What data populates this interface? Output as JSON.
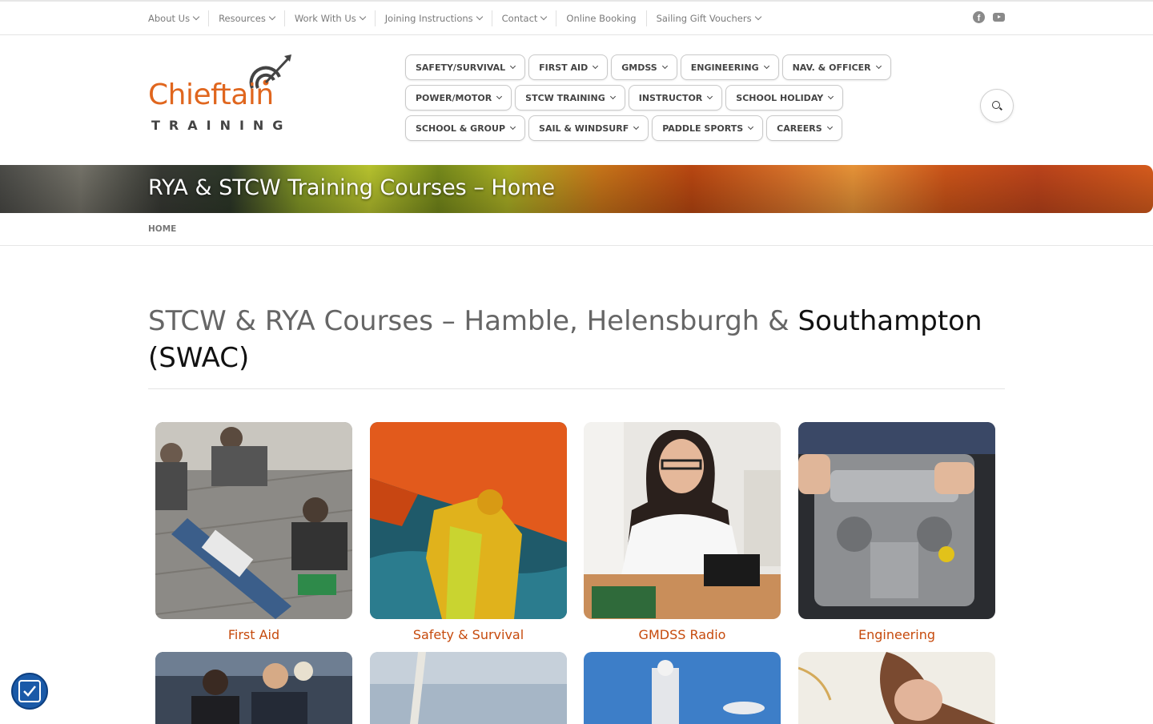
{
  "topnav": {
    "items": [
      {
        "label": "About Us",
        "dropdown": true
      },
      {
        "label": "Resources",
        "dropdown": true
      },
      {
        "label": "Work With Us",
        "dropdown": true
      },
      {
        "label": "Joining Instructions",
        "dropdown": true
      },
      {
        "label": "Contact",
        "dropdown": true
      },
      {
        "label": "Online Booking",
        "dropdown": false
      },
      {
        "label": "Sailing Gift Vouchers",
        "dropdown": true
      }
    ],
    "social": [
      "facebook-icon",
      "youtube-icon"
    ]
  },
  "logo": {
    "word": "Chieftain",
    "sub": "TRAINING",
    "color": "#e0661e"
  },
  "mainnav": {
    "rows": [
      [
        "SAFETY/SURVIVAL",
        "FIRST AID",
        "GMDSS",
        "ENGINEERING",
        "NAV. & OFFICER"
      ],
      [
        "POWER/MOTOR",
        "STCW TRAINING",
        "INSTRUCTOR",
        "SCHOOL HOLIDAY"
      ],
      [
        "SCHOOL & GROUP",
        "SAIL & WINDSURF",
        "PADDLE SPORTS",
        "CAREERS"
      ]
    ]
  },
  "banner": {
    "title": "RYA & STCW Training Courses – Home"
  },
  "breadcrumb": {
    "home": "HOME"
  },
  "main": {
    "heading_part1": "STCW & RYA Courses – Hamble, Helensburgh & ",
    "heading_part2": "Southampton (SWAC)",
    "courses": [
      {
        "label": "First Aid"
      },
      {
        "label": "Safety & Survival"
      },
      {
        "label": "GMDSS Radio"
      },
      {
        "label": "Engineering"
      }
    ]
  },
  "colors": {
    "accent": "#c64a0c",
    "brand_orange": "#e0661e",
    "accessibility": "#1a5aa8"
  }
}
